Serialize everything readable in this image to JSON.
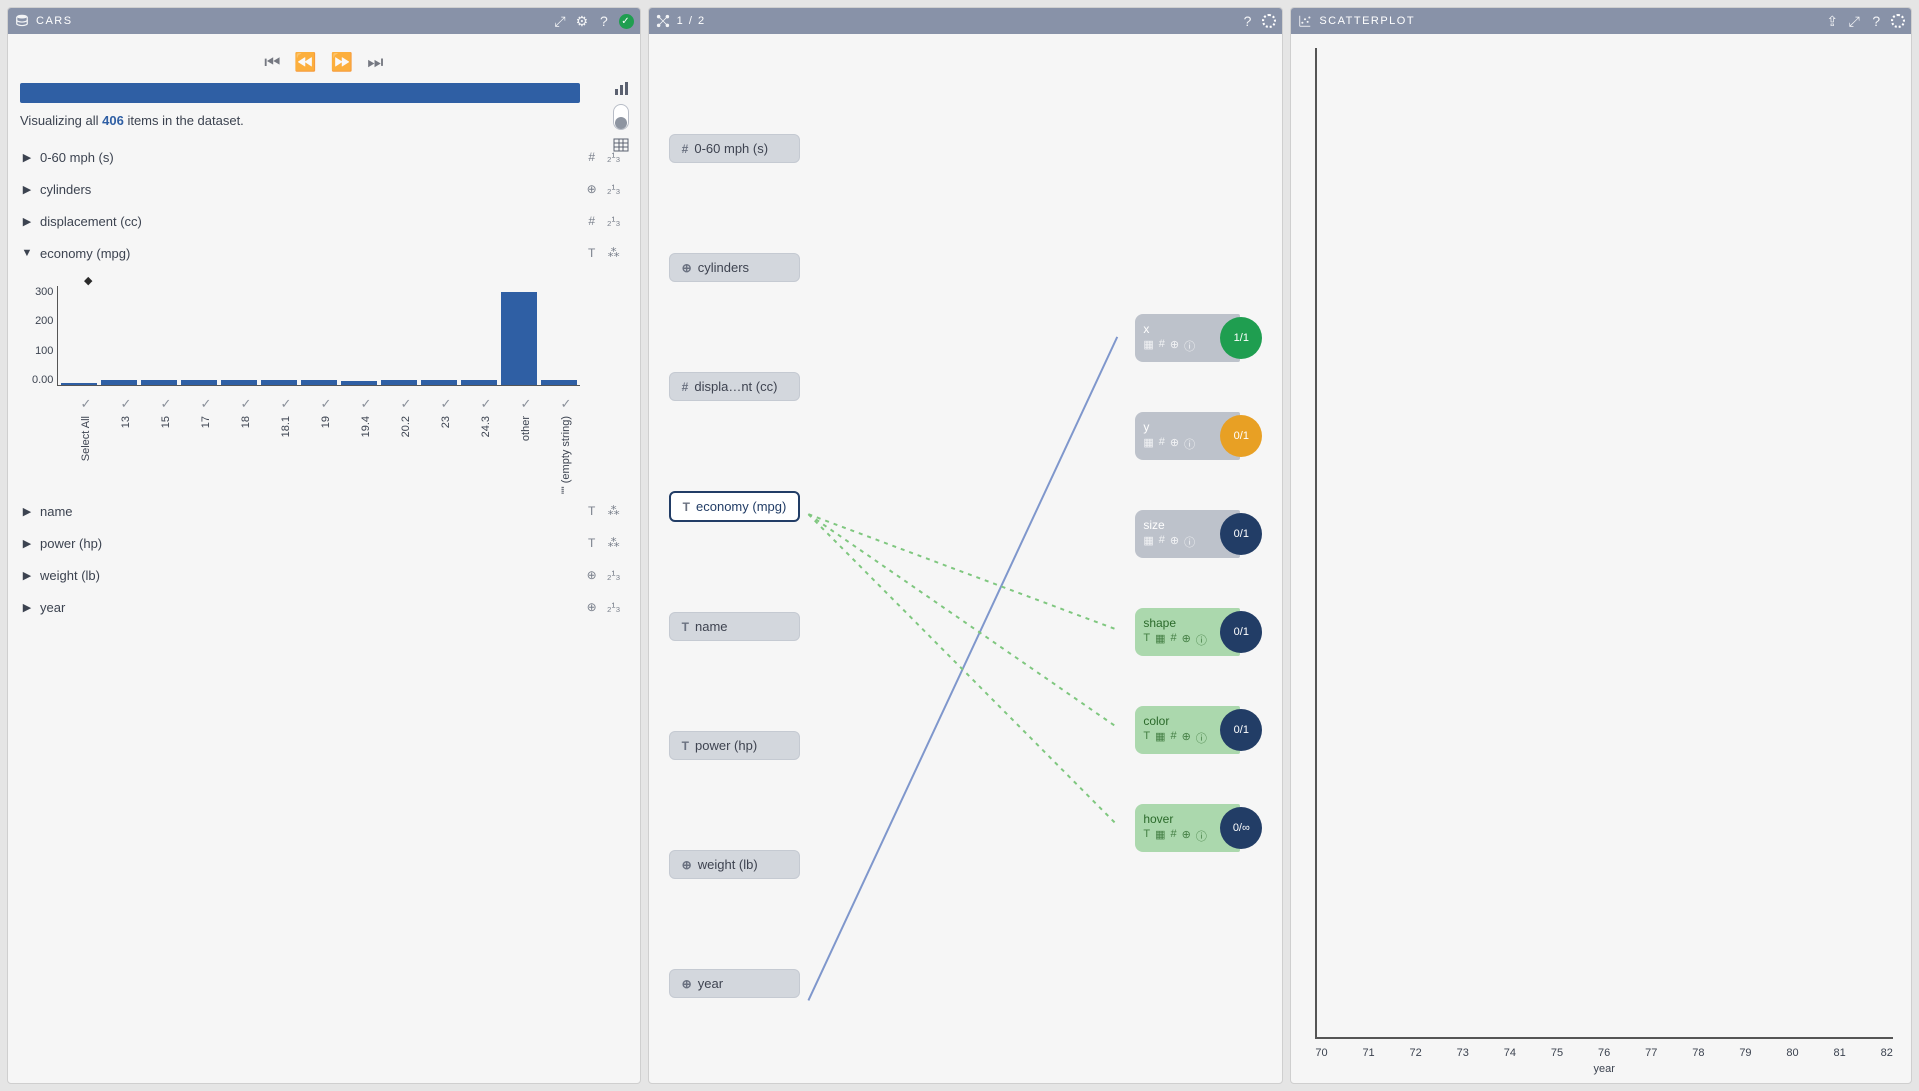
{
  "cars": {
    "title": "CARS",
    "viz_prefix": "Visualizing all ",
    "viz_count": "406",
    "viz_suffix": " items in the dataset.",
    "attrs": [
      {
        "label": "0-60 mph (s)",
        "open": false,
        "t1": "#",
        "t2": "₂¹₃"
      },
      {
        "label": "cylinders",
        "open": false,
        "t1": "⊕",
        "t2": "₂¹₃"
      },
      {
        "label": "displacement (cc)",
        "open": false,
        "t1": "#",
        "t2": "₂¹₃"
      },
      {
        "label": "economy (mpg)",
        "open": true,
        "t1": "T",
        "t2": "⁂"
      },
      {
        "label": "name",
        "open": false,
        "t1": "T",
        "t2": "⁂"
      },
      {
        "label": "power (hp)",
        "open": false,
        "t1": "T",
        "t2": "⁂"
      },
      {
        "label": "weight (lb)",
        "open": false,
        "t1": "⊕",
        "t2": "₂¹₃"
      },
      {
        "label": "year",
        "open": false,
        "t1": "⊕",
        "t2": "₂¹₃"
      }
    ],
    "chart_data": {
      "type": "bar",
      "ylabel": "",
      "ylim": [
        0,
        300
      ],
      "yticks": [
        "300",
        "200",
        "100",
        "0.00"
      ],
      "categories": [
        "Select All",
        "13",
        "15",
        "17",
        "18",
        "18.1",
        "19",
        "19.4",
        "20.2",
        "23",
        "24.3",
        "other",
        "\"\" (empty string)"
      ],
      "values": [
        0,
        15,
        15,
        15,
        15,
        15,
        15,
        12,
        15,
        15,
        15,
        280,
        15
      ]
    }
  },
  "mid": {
    "title": "1 / 2",
    "sources": [
      {
        "label": "0-60 mph (s)",
        "icon": "#"
      },
      {
        "label": "cylinders",
        "icon": "⊕"
      },
      {
        "label": "displa…nt (cc)",
        "icon": "#"
      },
      {
        "label": "economy (mpg)",
        "icon": "T",
        "selected": true
      },
      {
        "label": "name",
        "icon": "T"
      },
      {
        "label": "power (hp)",
        "icon": "T"
      },
      {
        "label": "weight (lb)",
        "icon": "⊕"
      },
      {
        "label": "year",
        "icon": "⊕"
      }
    ],
    "targets": [
      {
        "name": "x",
        "variant": "gray",
        "badge": "1/1",
        "color": "green"
      },
      {
        "name": "y",
        "variant": "gray",
        "badge": "0/1",
        "color": "orange"
      },
      {
        "name": "size",
        "variant": "gray",
        "badge": "0/1",
        "color": "navy"
      },
      {
        "name": "shape",
        "variant": "green",
        "badge": "0/1",
        "color": "navy"
      },
      {
        "name": "color",
        "variant": "green",
        "badge": "0/1",
        "color": "navy"
      },
      {
        "name": "hover",
        "variant": "green",
        "badge": "0/∞",
        "color": "navy"
      }
    ],
    "target_icons_gray": [
      "▦",
      "#",
      "⊕",
      "ⓘ"
    ],
    "target_icons_green": [
      "T",
      "▦",
      "#",
      "⊕",
      "ⓘ"
    ]
  },
  "scatter": {
    "title": "SCATTERPLOT",
    "xlabel": "year",
    "xticks": [
      "70",
      "71",
      "72",
      "73",
      "74",
      "75",
      "76",
      "77",
      "78",
      "79",
      "80",
      "81",
      "82"
    ]
  }
}
